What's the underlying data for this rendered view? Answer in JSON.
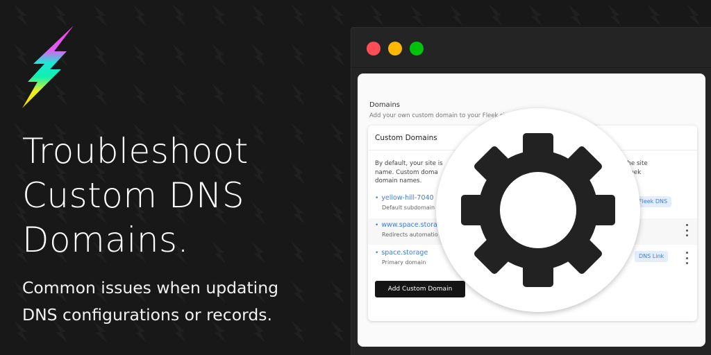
{
  "hero": {
    "headline": [
      "Troubleshoot",
      "Custom DNS",
      "Domains."
    ],
    "subhead": [
      "Common issues when updating",
      "DNS configurations or records."
    ]
  },
  "window": {
    "traffic_lights": [
      {
        "name": "close",
        "color": "#ff4d55"
      },
      {
        "name": "minimize",
        "color": "#ffb700"
      },
      {
        "name": "maximize",
        "color": "#00c20c"
      }
    ]
  },
  "domains_page": {
    "section_title": "Domains",
    "section_description": "Add your own custom domain to your Fleek si",
    "card": {
      "title": "Custom Domains",
      "description_left": [
        "By default, your site is",
        "name. Custom doma",
        "domain names."
      ],
      "description_right": [
        "the site",
        "Fleek"
      ],
      "domains": [
        {
          "name": "yellow-hill-7040",
          "subtitle": "Default subdomain",
          "badge": "Fleek DNS",
          "has_menu": false
        },
        {
          "name": "www.space.stora",
          "subtitle": "Redirects automatio",
          "badge": null,
          "has_menu": true
        },
        {
          "name": "space.storage",
          "subtitle": "Primary domain",
          "badge": "DNS Link",
          "has_menu": true
        }
      ],
      "add_button_label": "Add Custom Domain"
    }
  },
  "overlay": {
    "icon": "gear-icon"
  },
  "colors": {
    "background": "#181818",
    "window": "#242424",
    "link": "#3b7ddd",
    "badge_bg": "#e3edfc",
    "button": "#141414"
  }
}
